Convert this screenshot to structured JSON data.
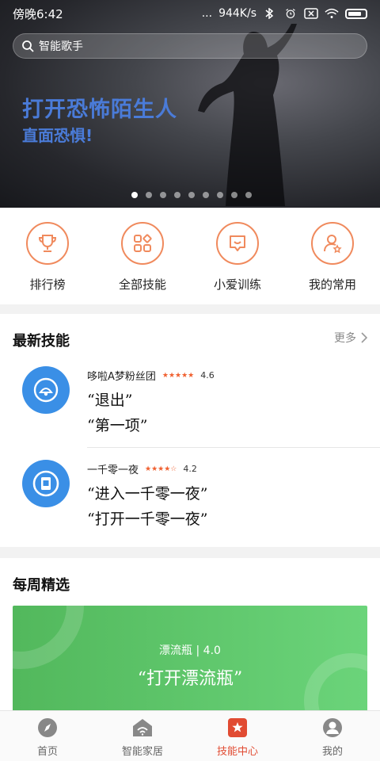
{
  "status_bar": {
    "time": "傍晚6:42",
    "dots": "...",
    "speed": "944K/s"
  },
  "search": {
    "placeholder": "智能歌手"
  },
  "hero": {
    "title": "打开恐怖陌生人",
    "subtitle": "直面恐惧!",
    "slide_count": 9,
    "active_slide": 0
  },
  "quick_nav": [
    {
      "label": "排行榜",
      "icon": "trophy-icon"
    },
    {
      "label": "全部技能",
      "icon": "grid-apps-icon"
    },
    {
      "label": "小爱训练",
      "icon": "chat-bubble-icon"
    },
    {
      "label": "我的常用",
      "icon": "user-star-icon"
    }
  ],
  "latest": {
    "title": "最新技能",
    "more": "更多",
    "items": [
      {
        "name": "哆啦A梦粉丝团",
        "stars": "★★★★★",
        "rating": "4.6",
        "quote1": "“退出”",
        "quote2": "“第一项”",
        "icon": "bell-icon",
        "color": "#3a8fe6"
      },
      {
        "name": "一千零一夜",
        "stars": "★★★★☆",
        "rating": "4.2",
        "quote1": "“进入一千零一夜”",
        "quote2": "“打开一千零一夜”",
        "icon": "book-icon",
        "color": "#3a8fe6"
      }
    ]
  },
  "weekly": {
    "title": "每周精选",
    "meta": "漂流瓶 | 4.0",
    "quote": "“打开漂流瓶”"
  },
  "tabs": [
    {
      "label": "首页",
      "icon": "compass-icon",
      "active": false
    },
    {
      "label": "智能家居",
      "icon": "home-wifi-icon",
      "active": false
    },
    {
      "label": "技能中心",
      "icon": "star-box-icon",
      "active": true
    },
    {
      "label": "我的",
      "icon": "user-icon",
      "active": false
    }
  ],
  "colors": {
    "accent": "#e14b32",
    "hero_text": "#4a7bd8",
    "quick_ring": "#f08a5d",
    "weekly_card": "#5cc46a"
  }
}
